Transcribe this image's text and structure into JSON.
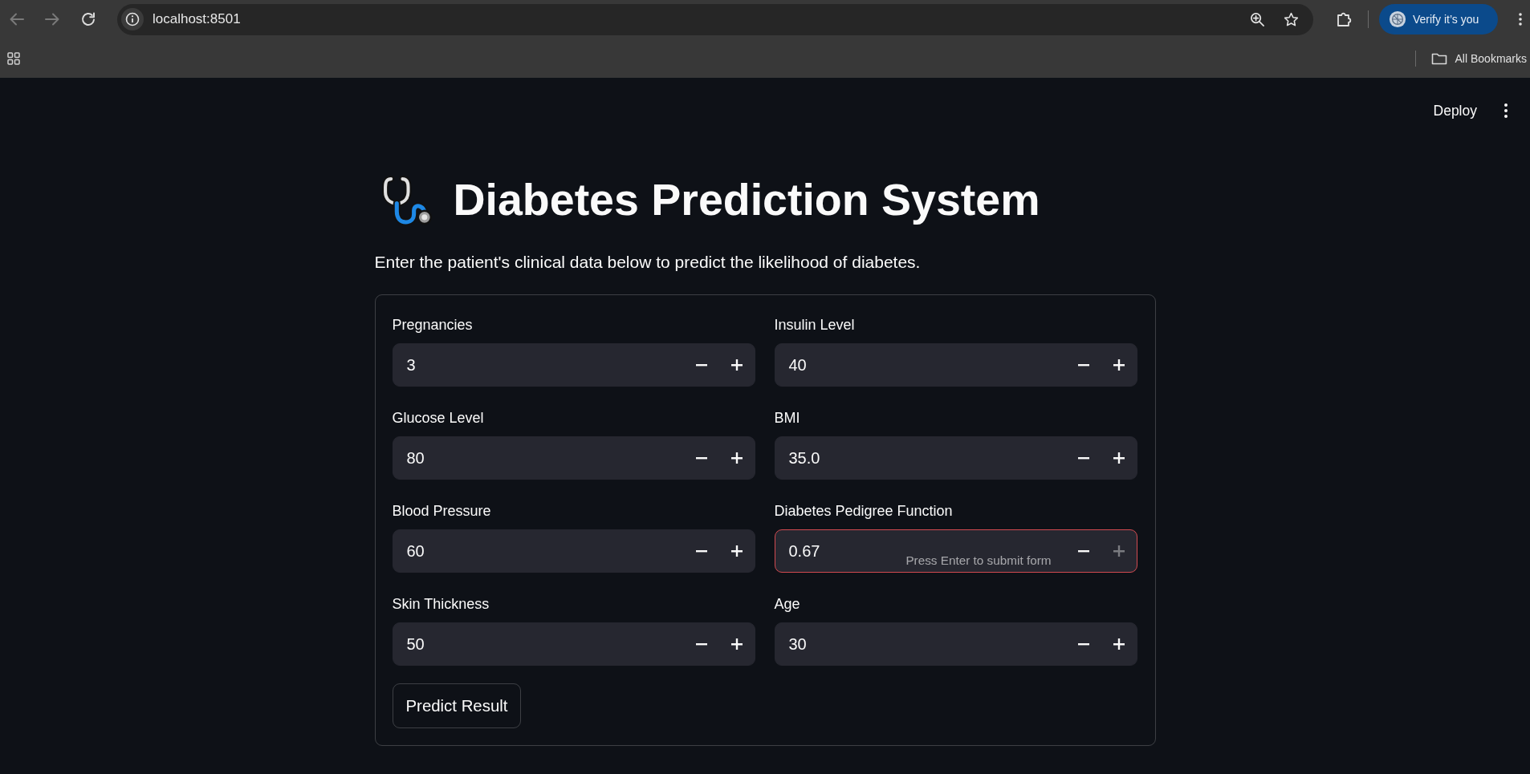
{
  "browser": {
    "back": {
      "disabled": true
    },
    "forward": {
      "disabled": true
    },
    "url": "localhost:8501",
    "profile_button": "Verify it’s you",
    "bookmarks_folder": "All Bookmarks"
  },
  "app_header": {
    "deploy_button": "Deploy"
  },
  "title": "Diabetes Prediction System",
  "subtitle": "Enter the patient's clinical data below to predict the likelihood of diabetes.",
  "form": {
    "columns": [
      {
        "fields": [
          {
            "label": "Pregnancies",
            "value": "3",
            "focused": false,
            "increment_disabled": false
          },
          {
            "label": "Glucose Level",
            "value": "80",
            "focused": false,
            "increment_disabled": false
          },
          {
            "label": "Blood Pressure",
            "value": "60",
            "focused": false,
            "increment_disabled": false
          },
          {
            "label": "Skin Thickness",
            "value": "50",
            "focused": false,
            "increment_disabled": false
          }
        ]
      },
      {
        "fields": [
          {
            "label": "Insulin Level",
            "value": "40",
            "focused": false,
            "increment_disabled": false
          },
          {
            "label": "BMI",
            "value": "35.0",
            "focused": false,
            "increment_disabled": false
          },
          {
            "label": "Diabetes Pedigree Function",
            "value": "0.67",
            "focused": true,
            "increment_disabled": true,
            "hint": "Press Enter to submit form"
          },
          {
            "label": "Age",
            "value": "30",
            "focused": false,
            "increment_disabled": false
          }
        ]
      }
    ],
    "submit_button": "Predict Result"
  }
}
